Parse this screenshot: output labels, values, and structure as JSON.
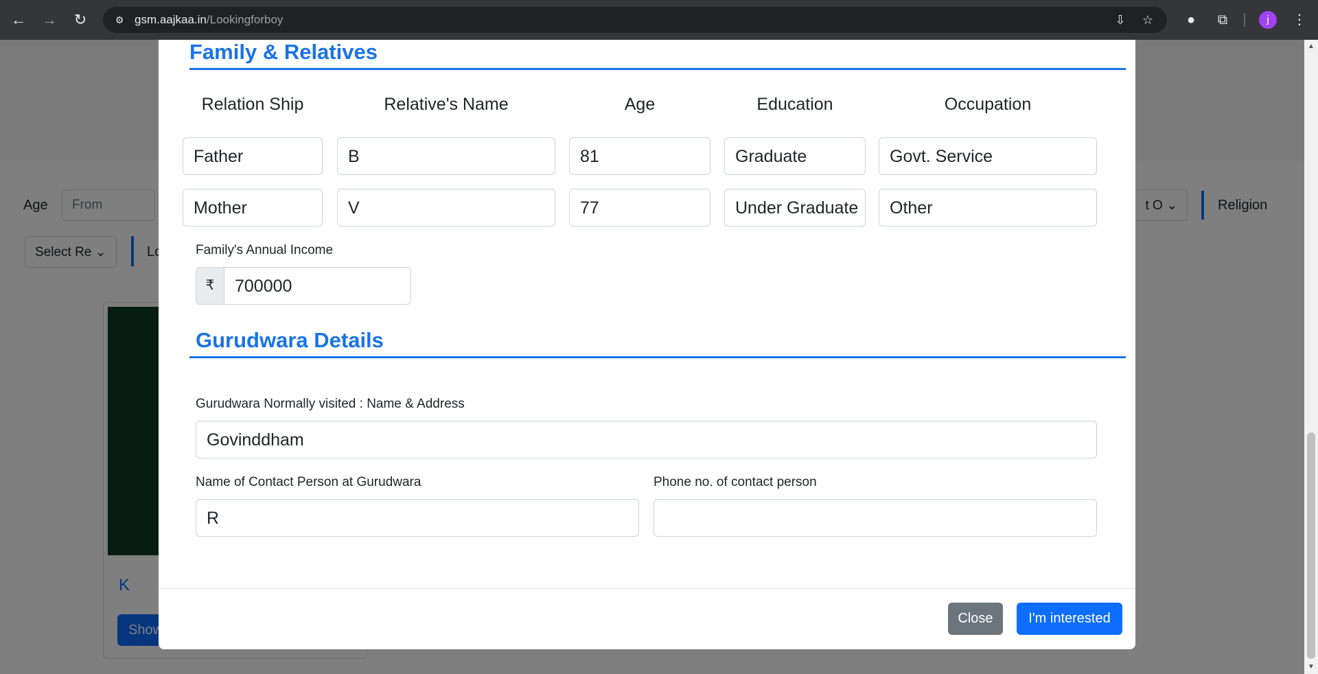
{
  "browser": {
    "url_host": "gsm.aajkaa.in",
    "url_path": "/Lookingforboy",
    "profile_initial": "j"
  },
  "background_page": {
    "age_label": "Age",
    "age_from_placeholder": "From",
    "select_right_partial": "t O",
    "religion_label": "Religion",
    "select_re_partial": "Select Re",
    "looking_partial": "Lo",
    "card_name": "K",
    "card_button": "Show"
  },
  "modal": {
    "family_section_title": "Family & Relatives",
    "columns": [
      "Relation Ship",
      "Relative's Name",
      "Age",
      "Education",
      "Occupation"
    ],
    "relatives": [
      {
        "relation": "Father",
        "name": "B",
        "age": "81",
        "education": "Graduate",
        "occupation": "Govt. Service"
      },
      {
        "relation": "Mother",
        "name": "V",
        "age": "77",
        "education": "Under Graduate",
        "occupation": "Other"
      }
    ],
    "income_label": "Family's Annual Income",
    "income_currency": "₹",
    "income_value": "700000",
    "gurudwara_section_title": "Gurudwara Details",
    "gurudwara_label": "Gurudwara Normally visited : Name & Address",
    "gurudwara_value": "Govinddham",
    "contact_name_label": "Name of Contact Person at Gurudwara",
    "contact_name_value": "R",
    "contact_phone_label": "Phone no. of contact person",
    "contact_phone_value": "",
    "close_button": "Close",
    "interested_button": "I'm interested"
  },
  "colors": {
    "accent": "#1a73e8",
    "primary_button": "#0d6efd",
    "secondary_button": "#6c757d"
  }
}
